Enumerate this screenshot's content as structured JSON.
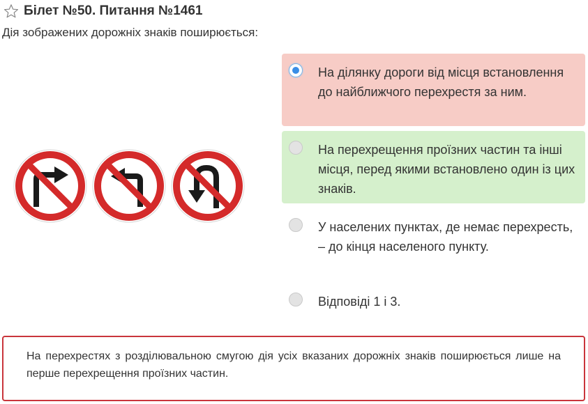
{
  "header": {
    "title": "Білет №50. Питання №1461",
    "star_icon": "star-outline-icon"
  },
  "question": {
    "text": "Дія зображених дорожніх знаків поширюється:"
  },
  "signs": [
    {
      "name": "no-right-turn-sign"
    },
    {
      "name": "no-left-turn-sign"
    },
    {
      "name": "no-u-turn-sign"
    }
  ],
  "answers": [
    {
      "text": "На ділянку дороги від місця встановлення до найближчого перехрестя за ним.",
      "state": "wrong",
      "selected": true
    },
    {
      "text": "На перехрещення проїзних частин та інші місця, перед якими встановлено один із цих знаків.",
      "state": "correct",
      "selected": false
    },
    {
      "text": "У населених пунктах, де немає перехресть, – до кінця населеного пункту.",
      "state": "neutral",
      "selected": false
    },
    {
      "text": "Відповіді 1 і 3.",
      "state": "neutral",
      "selected": false
    }
  ],
  "explanation": {
    "text": "На перехрестях з розділювальною смугою дія усіх вказаних дорожніх знаків поширюється лише на перше перехрещення проїзних частин."
  },
  "colors": {
    "wrong_bg": "#f7ccc6",
    "correct_bg": "#d5f0cc",
    "sign_red": "#d42a2a",
    "explanation_border": "#c9353b"
  }
}
